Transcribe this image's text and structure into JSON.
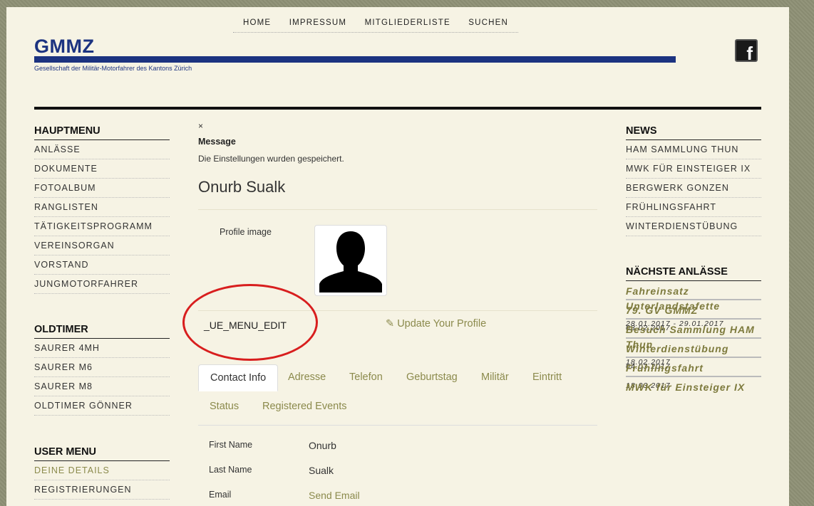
{
  "topnav": [
    "HOME",
    "IMPRESSUM",
    "MITGLIEDERLISTE",
    "SUCHEN"
  ],
  "logo": {
    "title": "GMMZ",
    "subtitle": "Gesellschaft der Militär-Motorfahrer des Kantons Zürich"
  },
  "facebook_icon": "f",
  "hauptmenu": {
    "title": "HAUPTMENU",
    "items": [
      "ANLÄSSE",
      "DOKUMENTE",
      "FOTOALBUM",
      "RANGLISTEN",
      "TÄTIGKEITSPROGRAMM",
      "VEREINSORGAN",
      "VORSTAND",
      "JUNGMOTORFAHRER"
    ]
  },
  "oldtimer": {
    "title": "OLDTIMER",
    "items": [
      "SAURER 4MH",
      "SAURER M6",
      "SAURER M8",
      "OLDTIMER GÖNNER"
    ]
  },
  "usermenu": {
    "title": "USER MENU",
    "items": [
      "DEINE DETAILS",
      "REGISTRIERUNGEN"
    ]
  },
  "news": {
    "title": "NEWS",
    "items": [
      "HAM SAMMLUNG THUN",
      "MWK FÜR EINSTEIGER IX",
      "BERGWERK GONZEN",
      "FRÜHLINGSFAHRT",
      "WINTERDIENSTÜBUNG"
    ]
  },
  "events": {
    "title": "NÄCHSTE ANLÄSSE",
    "items": [
      {
        "title": "Fahreinsatz Unterlandstafette",
        "date": "28.01.2017 - 29.01.2017"
      },
      {
        "title": "79. GV GMMZ",
        "date": "03.02.2017"
      },
      {
        "title": "Besuch Sammlung HAM Thun",
        "date": "18.02.2017"
      },
      {
        "title": "Winterdienstübung",
        "date": "04.03.2017"
      },
      {
        "title": "Frühlingsfahrt",
        "date": "18.03.2017"
      },
      {
        "title": "MWK für Einsteiger IX",
        "date": ""
      }
    ]
  },
  "main": {
    "close": "×",
    "message_title": "Message",
    "message_text": "Die Einstellungen wurden gespeichert.",
    "name": "Onurb Sualk",
    "profile_image_label": "Profile image",
    "ue_menu_edit": "_UE_MENU_EDIT",
    "update_profile": "Update Your Profile",
    "tabs_row1": [
      "Contact Info",
      "Adresse",
      "Telefon",
      "Geburtstag",
      "Militär",
      "Eintritt"
    ],
    "tabs_row2": [
      "Status",
      "Registered Events"
    ],
    "fields": [
      {
        "label": "First Name",
        "value": "Onurb"
      },
      {
        "label": "Last Name",
        "value": "Sualk"
      },
      {
        "label": "Email",
        "value": "Send Email"
      }
    ]
  },
  "colors": {
    "accent": "#8b8a4c",
    "brand": "#1c3380",
    "annotation": "#d81e1e"
  }
}
